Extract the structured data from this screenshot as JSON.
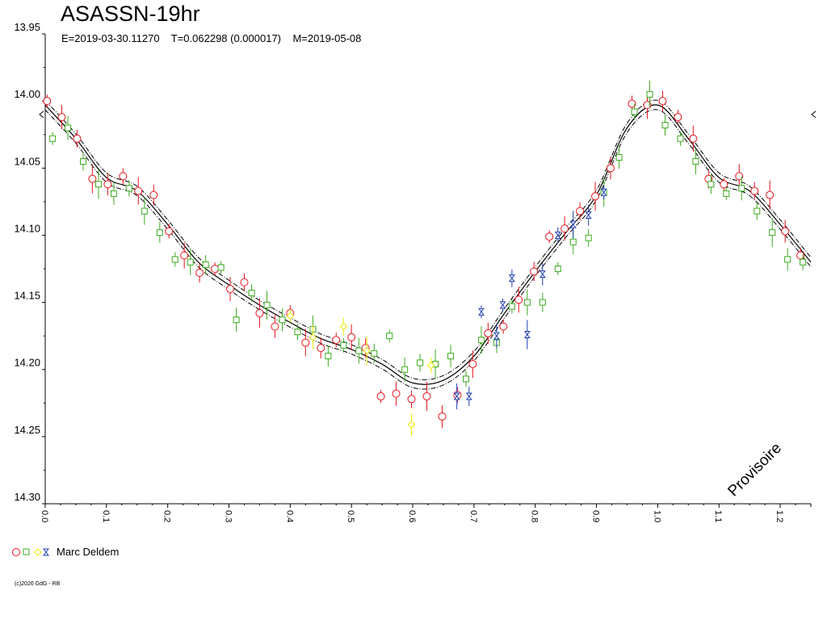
{
  "title": "ASASSN-19hr",
  "subtitle": "E=2019-03-30.11270    T=0.062298 (0.000017)    M=2019-05-08",
  "legend": {
    "observer": "Marc Deldem"
  },
  "copyright": "(c)2026 GdG - RB",
  "watermark": "Provisoire",
  "colors": {
    "red": "#e8141e",
    "green": "#3caa1e",
    "yellow": "#ecec00",
    "blue": "#1e3cb4",
    "curve": "#000000"
  },
  "chart_data": {
    "type": "scatter",
    "xlabel": "",
    "ylabel": "",
    "xlim": [
      0.0,
      1.25
    ],
    "ylim": [
      14.3,
      13.95
    ],
    "y_inverted": true,
    "y_ticks": [
      "13.95",
      "14.00",
      "14.05",
      "14.10",
      "14.15",
      "14.20",
      "14.25",
      "14.30"
    ],
    "x_ticks": [
      "0.0",
      "0.1",
      "0.2",
      "0.3",
      "0.4",
      "0.5",
      "0.6",
      "0.7",
      "0.8",
      "0.9",
      "1.0",
      "1.1",
      "1.2"
    ],
    "series": [
      {
        "color": "red",
        "marker": "circle",
        "points": [
          [
            0.003,
            14.0
          ],
          [
            0.027,
            14.012
          ],
          [
            0.052,
            14.028
          ],
          [
            0.077,
            14.058
          ],
          [
            0.102,
            14.062
          ],
          [
            0.127,
            14.056
          ],
          [
            0.152,
            14.067
          ],
          [
            0.177,
            14.07
          ],
          [
            0.202,
            14.097
          ],
          [
            0.227,
            14.115
          ],
          [
            0.252,
            14.128
          ],
          [
            0.277,
            14.125
          ],
          [
            0.302,
            14.14
          ],
          [
            0.325,
            14.135
          ],
          [
            0.35,
            14.158
          ],
          [
            0.375,
            14.168
          ],
          [
            0.4,
            14.158
          ],
          [
            0.425,
            14.18
          ],
          [
            0.45,
            14.184
          ],
          [
            0.475,
            14.178
          ],
          [
            0.5,
            14.176
          ],
          [
            0.523,
            14.184
          ],
          [
            0.548,
            14.22
          ],
          [
            0.573,
            14.218
          ],
          [
            0.598,
            14.222
          ],
          [
            0.623,
            14.22
          ],
          [
            0.648,
            14.235
          ],
          [
            0.673,
            14.219
          ],
          [
            0.698,
            14.196
          ],
          [
            0.723,
            14.173
          ],
          [
            0.748,
            14.168
          ],
          [
            0.773,
            14.148
          ],
          [
            0.798,
            14.127
          ],
          [
            0.823,
            14.101
          ],
          [
            0.848,
            14.095
          ],
          [
            0.873,
            14.082
          ],
          [
            0.898,
            14.071
          ],
          [
            0.923,
            14.05
          ],
          [
            0.958,
            14.002
          ],
          [
            0.983,
            14.003
          ],
          [
            1.008,
            14.0
          ],
          [
            1.033,
            14.012
          ],
          [
            1.058,
            14.028
          ],
          [
            1.083,
            14.058
          ],
          [
            1.108,
            14.062
          ],
          [
            1.133,
            14.056
          ],
          [
            1.158,
            14.067
          ],
          [
            1.183,
            14.07
          ],
          [
            1.208,
            14.097
          ],
          [
            1.233,
            14.115
          ]
        ]
      },
      {
        "color": "green",
        "marker": "square",
        "points": [
          [
            0.012,
            14.028
          ],
          [
            0.037,
            14.02
          ],
          [
            0.062,
            14.045
          ],
          [
            0.087,
            14.062
          ],
          [
            0.112,
            14.069
          ],
          [
            0.137,
            14.065
          ],
          [
            0.162,
            14.082
          ],
          [
            0.187,
            14.098
          ],
          [
            0.212,
            14.118
          ],
          [
            0.237,
            14.12
          ],
          [
            0.262,
            14.122
          ],
          [
            0.287,
            14.124
          ],
          [
            0.312,
            14.163
          ],
          [
            0.337,
            14.143
          ],
          [
            0.362,
            14.152
          ],
          [
            0.387,
            14.163
          ],
          [
            0.412,
            14.172
          ],
          [
            0.437,
            14.17
          ],
          [
            0.462,
            14.19
          ],
          [
            0.487,
            14.182
          ],
          [
            0.512,
            14.186
          ],
          [
            0.537,
            14.188
          ],
          [
            0.562,
            14.175
          ],
          [
            0.587,
            14.2
          ],
          [
            0.612,
            14.195
          ],
          [
            0.637,
            14.196
          ],
          [
            0.662,
            14.19
          ],
          [
            0.687,
            14.207
          ],
          [
            0.712,
            14.178
          ],
          [
            0.737,
            14.18
          ],
          [
            0.762,
            14.153
          ],
          [
            0.787,
            14.15
          ],
          [
            0.812,
            14.15
          ],
          [
            0.837,
            14.125
          ],
          [
            0.862,
            14.105
          ],
          [
            0.887,
            14.102
          ],
          [
            0.912,
            14.068
          ],
          [
            0.937,
            14.042
          ],
          [
            0.962,
            14.008
          ],
          [
            0.987,
            13.995
          ],
          [
            1.012,
            14.018
          ],
          [
            1.037,
            14.028
          ],
          [
            1.062,
            14.045
          ],
          [
            1.087,
            14.062
          ],
          [
            1.112,
            14.069
          ],
          [
            1.137,
            14.065
          ],
          [
            1.162,
            14.082
          ],
          [
            1.187,
            14.098
          ],
          [
            1.212,
            14.118
          ],
          [
            1.237,
            14.12
          ]
        ]
      },
      {
        "color": "yellow",
        "marker": "diamond",
        "points": [
          [
            0.4,
            14.16
          ],
          [
            0.437,
            14.176
          ],
          [
            0.487,
            14.168
          ],
          [
            0.525,
            14.186
          ],
          [
            0.598,
            14.241
          ],
          [
            0.63,
            14.197
          ]
        ]
      },
      {
        "color": "blue",
        "marker": "hourglass",
        "points": [
          [
            0.712,
            14.157
          ],
          [
            0.737,
            14.175
          ],
          [
            0.762,
            14.132
          ],
          [
            0.787,
            14.174
          ],
          [
            0.812,
            14.129
          ],
          [
            0.837,
            14.1
          ],
          [
            0.862,
            14.092
          ],
          [
            0.887,
            14.085
          ],
          [
            0.912,
            14.068
          ],
          [
            0.672,
            14.22
          ],
          [
            0.692,
            14.22
          ],
          [
            0.747,
            14.152
          ]
        ]
      }
    ],
    "curve": {
      "fit": [
        [
          0.0,
          14.003
        ],
        [
          0.05,
          14.028
        ],
        [
          0.1,
          14.057
        ],
        [
          0.15,
          14.067
        ],
        [
          0.2,
          14.092
        ],
        [
          0.25,
          14.12
        ],
        [
          0.3,
          14.137
        ],
        [
          0.35,
          14.152
        ],
        [
          0.4,
          14.165
        ],
        [
          0.45,
          14.177
        ],
        [
          0.5,
          14.185
        ],
        [
          0.55,
          14.196
        ],
        [
          0.6,
          14.21
        ],
        [
          0.65,
          14.208
        ],
        [
          0.7,
          14.19
        ],
        [
          0.75,
          14.158
        ],
        [
          0.8,
          14.127
        ],
        [
          0.85,
          14.098
        ],
        [
          0.9,
          14.07
        ],
        [
          0.95,
          14.02
        ],
        [
          1.0,
          14.003
        ],
        [
          1.05,
          14.028
        ],
        [
          1.1,
          14.057
        ],
        [
          1.15,
          14.067
        ],
        [
          1.2,
          14.092
        ],
        [
          1.25,
          14.12
        ]
      ],
      "band": 0.0035
    }
  }
}
